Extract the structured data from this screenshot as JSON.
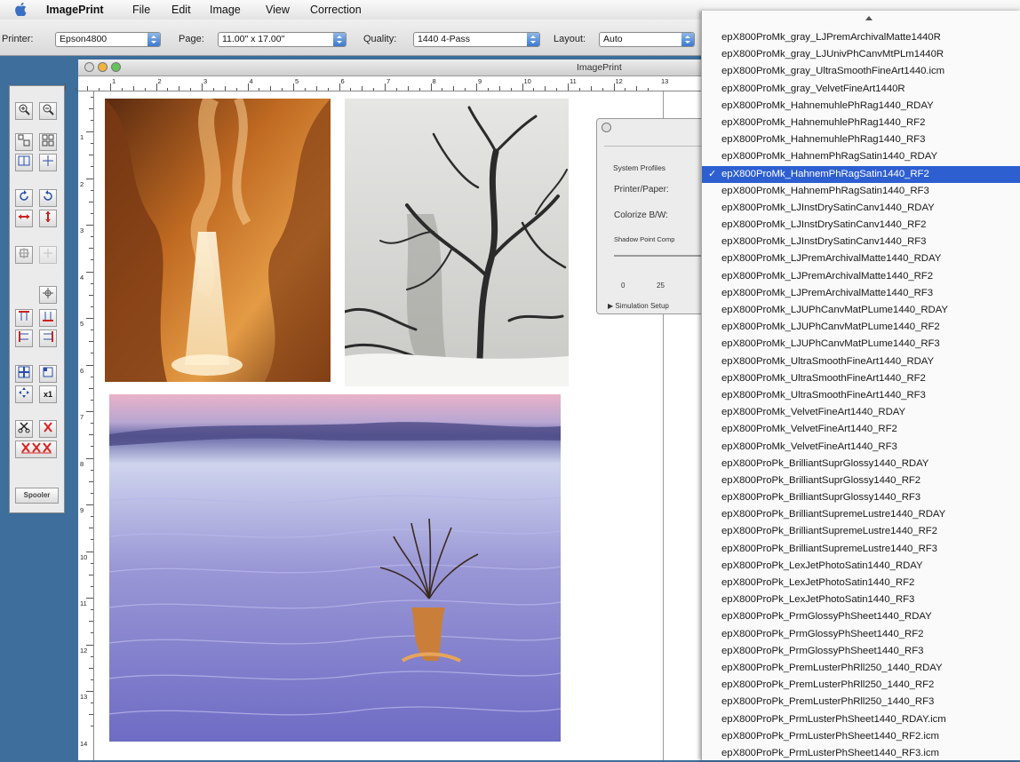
{
  "menubar": {
    "app_name": "ImagePrint",
    "items": [
      "File",
      "Edit",
      "Image",
      "View",
      "Correction"
    ]
  },
  "toolbar": {
    "printer_label": "Printer:",
    "printer_value": "Epson4800",
    "page_label": "Page:",
    "page_value": "11.00\" x 17.00\"",
    "quality_label": "Quality:",
    "quality_value": "1440 4-Pass",
    "layout_label": "Layout:",
    "layout_value": "Auto"
  },
  "window": {
    "title": "ImagePrint",
    "hruler_numbers": [
      "1",
      "2",
      "3",
      "4",
      "5",
      "6",
      "7",
      "8",
      "9",
      "10",
      "11",
      "12",
      "13"
    ],
    "vruler_numbers": [
      "1",
      "2",
      "3",
      "4",
      "5",
      "6",
      "7",
      "8",
      "9",
      "10",
      "11",
      "12",
      "13",
      "14"
    ]
  },
  "palette": {
    "spooler_label": "Spooler",
    "x1_label": "x1"
  },
  "panel": {
    "section": "System Profiles",
    "printer_paper_label": "Printer/Paper:",
    "colorize_label": "Colorize B/W:",
    "shadow_label": "Shadow Point Comp",
    "scale_0": "0",
    "scale_25": "25",
    "simulation_label": "Simulation Setup"
  },
  "dropdown": {
    "selected_index": 8,
    "items": [
      "epX800ProMk_gray_LJPremArchivalMatte1440R",
      "epX800ProMk_gray_LJUnivPhCanvMtPLm1440R",
      "epX800ProMk_gray_UltraSmoothFineArt1440.icm",
      "epX800ProMk_gray_VelvetFineArt1440R",
      "epX800ProMk_HahnemuhlePhRag1440_RDAY",
      "epX800ProMk_HahnemuhlePhRag1440_RF2",
      "epX800ProMk_HahnemuhlePhRag1440_RF3",
      "epX800ProMk_HahnemPhRagSatin1440_RDAY",
      "epX800ProMk_HahnemPhRagSatin1440_RF2",
      "epX800ProMk_HahnemPhRagSatin1440_RF3",
      "epX800ProMk_LJInstDrySatinCanv1440_RDAY",
      "epX800ProMk_LJInstDrySatinCanv1440_RF2",
      "epX800ProMk_LJInstDrySatinCanv1440_RF3",
      "epX800ProMk_LJPremArchivalMatte1440_RDAY",
      "epX800ProMk_LJPremArchivalMatte1440_RF2",
      "epX800ProMk_LJPremArchivalMatte1440_RF3",
      "epX800ProMk_LJUPhCanvMatPLume1440_RDAY",
      "epX800ProMk_LJUPhCanvMatPLume1440_RF2",
      "epX800ProMk_LJUPhCanvMatPLume1440_RF3",
      "epX800ProMk_UltraSmoothFineArt1440_RDAY",
      "epX800ProMk_UltraSmoothFineArt1440_RF2",
      "epX800ProMk_UltraSmoothFineArt1440_RF3",
      "epX800ProMk_VelvetFineArt1440_RDAY",
      "epX800ProMk_VelvetFineArt1440_RF2",
      "epX800ProMk_VelvetFineArt1440_RF3",
      "epX800ProPk_BrilliantSuprGlossy1440_RDAY",
      "epX800ProPk_BrilliantSuprGlossy1440_RF2",
      "epX800ProPk_BrilliantSuprGlossy1440_RF3",
      "epX800ProPk_BrilliantSupremeLustre1440_RDAY",
      "epX800ProPk_BrilliantSupremeLustre1440_RF2",
      "epX800ProPk_BrilliantSupremeLustre1440_RF3",
      "epX800ProPk_LexJetPhotoSatin1440_RDAY",
      "epX800ProPk_LexJetPhotoSatin1440_RF2",
      "epX800ProPk_LexJetPhotoSatin1440_RF3",
      "epX800ProPk_PrmGlossyPhSheet1440_RDAY",
      "epX800ProPk_PrmGlossyPhSheet1440_RF2",
      "epX800ProPk_PrmGlossyPhSheet1440_RF3",
      "epX800ProPk_PremLusterPhRll250_1440_RDAY",
      "epX800ProPk_PremLusterPhRll250_1440_RF2",
      "epX800ProPk_PremLusterPhRll250_1440_RF3",
      "epX800ProPk_PrmLusterPhSheet1440_RDAY.icm",
      "epX800ProPk_PrmLusterPhSheet1440_RF2.icm",
      "epX800ProPk_PrmLusterPhSheet1440_RF3.icm"
    ]
  }
}
